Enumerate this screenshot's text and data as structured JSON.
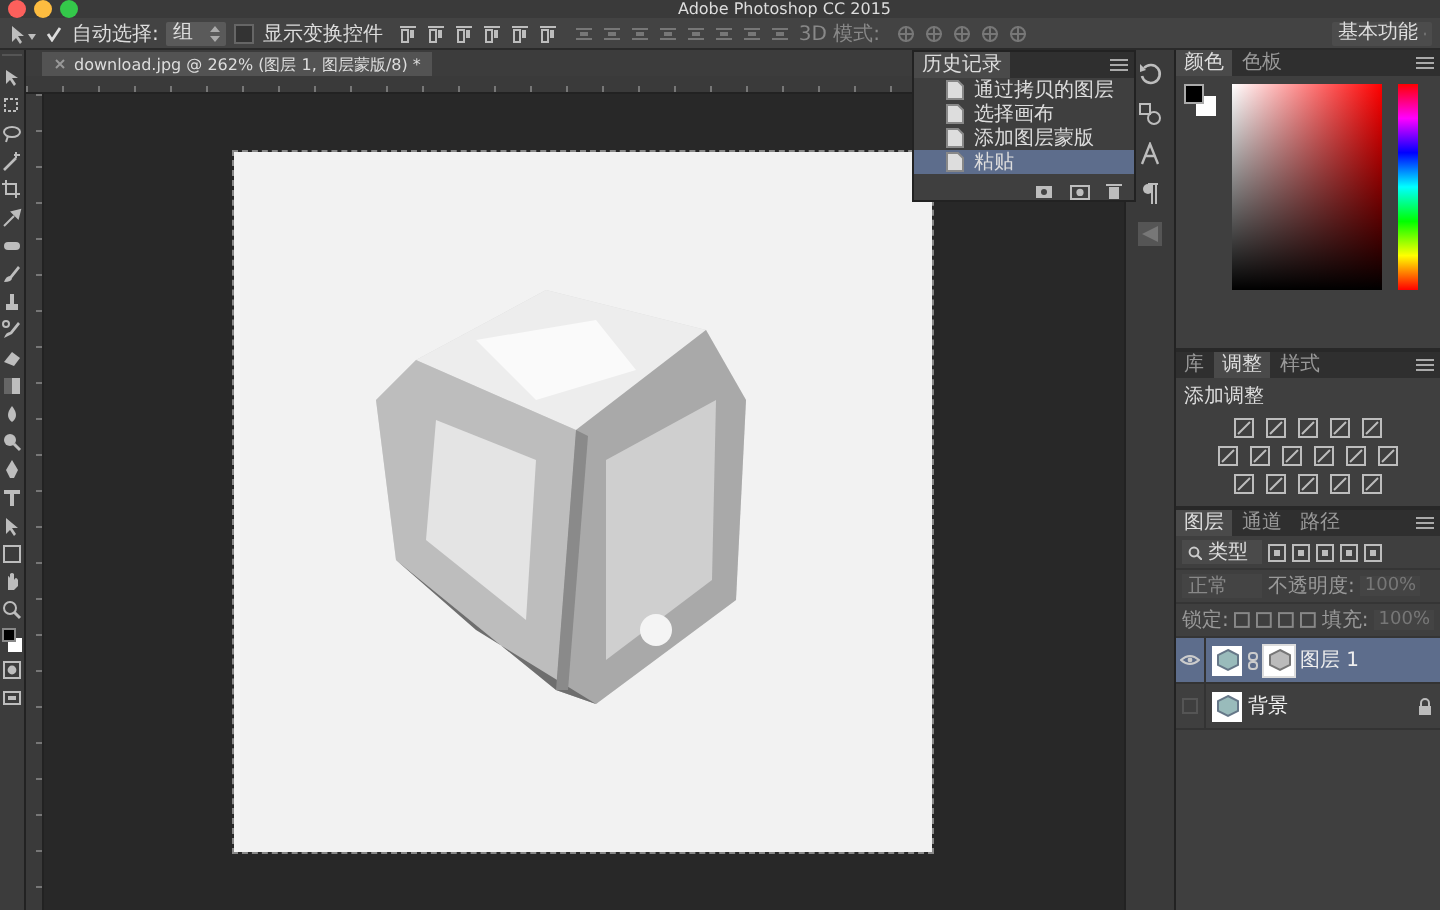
{
  "window": {
    "title": "Adobe Photoshop CC 2015"
  },
  "options_bar": {
    "auto_select": {
      "label": "自动选择:",
      "checked": true,
      "value": "组"
    },
    "show_transform": {
      "label": "显示变换控件",
      "checked": false
    },
    "mode_3d": "3D 模式:",
    "workspace": "基本功能"
  },
  "document_tab": {
    "title": "download.jpg @ 262% (图层 1, 图层蒙版/8) *"
  },
  "history_panel": {
    "title": "历史记录",
    "items": [
      {
        "label": "通过拷贝的图层",
        "selected": false
      },
      {
        "label": "选择画布",
        "selected": false
      },
      {
        "label": "添加图层蒙版",
        "selected": false
      },
      {
        "label": "粘贴",
        "selected": true
      }
    ]
  },
  "color_panel": {
    "tabs": [
      {
        "label": "颜色",
        "selected": true
      },
      {
        "label": "色板",
        "selected": false
      }
    ]
  },
  "adjustments_panel": {
    "tabs": [
      {
        "label": "库",
        "selected": false
      },
      {
        "label": "调整",
        "selected": true
      },
      {
        "label": "样式",
        "selected": false
      }
    ],
    "heading": "添加调整"
  },
  "layers_panel": {
    "tabs": [
      {
        "label": "图层",
        "selected": true
      },
      {
        "label": "通道",
        "selected": false
      },
      {
        "label": "路径",
        "selected": false
      }
    ],
    "filter": "类型",
    "blend_mode": "正常",
    "opacity_label": "不透明度:",
    "opacity": "100%",
    "lock_label": "锁定:",
    "fill_label": "填充:",
    "fill": "100%",
    "layers": [
      {
        "name": "图层 1",
        "selected": true,
        "visible": true,
        "has_mask": true,
        "locked": false
      },
      {
        "name": "背景",
        "selected": false,
        "visible": false,
        "has_mask": false,
        "locked": true
      }
    ]
  }
}
